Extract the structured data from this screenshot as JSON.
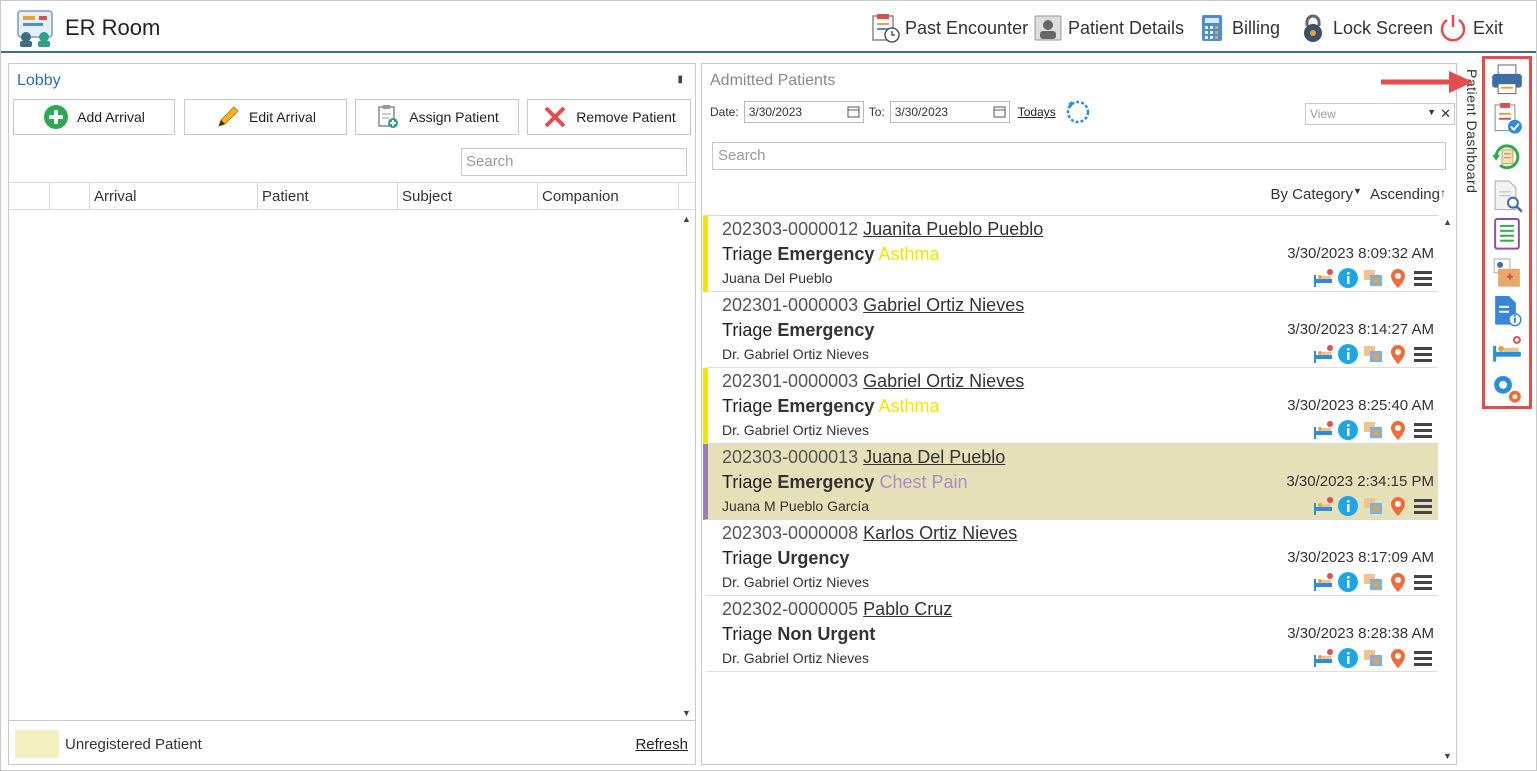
{
  "app": {
    "title": "ER Room"
  },
  "toolbar": {
    "past_encounter": "Past Encounter",
    "patient_details": "Patient Details",
    "billing": "Billing",
    "lock_screen": "Lock Screen",
    "exit": "Exit"
  },
  "lobby": {
    "title": "Lobby",
    "buttons": {
      "add_arrival": "Add Arrival",
      "edit_arrival": "Edit Arrival",
      "assign_patient": "Assign Patient",
      "remove_patient": "Remove Patient"
    },
    "search_placeholder": "Search",
    "columns": [
      "Arrival",
      "Patient",
      "Subject",
      "Companion"
    ],
    "legend_label": "Unregistered Patient",
    "legend_color": "#f3f0c0",
    "refresh": "Refresh"
  },
  "admitted": {
    "title": "Admitted Patients",
    "date_label": "Date:",
    "date_from": "3/30/2023",
    "to_label": "To:",
    "date_to": "3/30/2023",
    "todays": "Todays",
    "view_placeholder": "View",
    "search_placeholder": "Search",
    "sort_by": "By Category",
    "sort_order": "Ascending",
    "patients": [
      {
        "id": "202303-0000012",
        "name": "Juanita Pueblo Pueblo",
        "triage": "Triage",
        "level": "Emergency",
        "category": "Asthma",
        "companion": "Juana Del Pueblo",
        "time": "3/30/2023 8:09:32 AM"
      },
      {
        "id": "202301-0000003",
        "name": "Gabriel Ortiz Nieves",
        "triage": "Triage",
        "level": "Emergency",
        "category": "",
        "companion": "Dr. Gabriel Ortiz Nieves",
        "time": "3/30/2023 8:14:27 AM"
      },
      {
        "id": "202301-0000003",
        "name": "Gabriel Ortiz Nieves",
        "triage": "Triage",
        "level": "Emergency",
        "category": "Asthma",
        "companion": "Dr. Gabriel Ortiz Nieves",
        "time": "3/30/2023 8:25:40 AM"
      },
      {
        "id": "202303-0000013",
        "name": "Juana Del Pueblo",
        "triage": "Triage",
        "level": "Emergency",
        "category": "Chest Pain",
        "companion": "Juana M Pueblo García",
        "time": "3/30/2023 2:34:15 PM"
      },
      {
        "id": "202303-0000008",
        "name": "Karlos Ortiz Nieves",
        "triage": "Triage",
        "level": "Urgency",
        "category": "",
        "companion": "Dr. Gabriel Ortiz Nieves",
        "time": "3/30/2023 8:17:09 AM"
      },
      {
        "id": "202302-0000005",
        "name": "Pablo Cruz",
        "triage": "Triage",
        "level": "Non Urgent",
        "category": "",
        "companion": "Dr. Gabriel Ortiz Nieves",
        "time": "3/30/2023 8:28:38 AM"
      }
    ]
  },
  "dashboard": {
    "label": "Patient Dashboard",
    "icons": [
      "printer-icon",
      "checklist-icon",
      "history-icon",
      "document-search-icon",
      "clipboard-list-icon",
      "medical-record-icon",
      "patient-info-icon",
      "bed-icon",
      "settings-icon"
    ]
  },
  "colors": {
    "asthma": "#f2e400",
    "chest_pain": "#a98cc9",
    "selected_row": "#e5e0b7",
    "highlight_border": "#e34d4d"
  }
}
